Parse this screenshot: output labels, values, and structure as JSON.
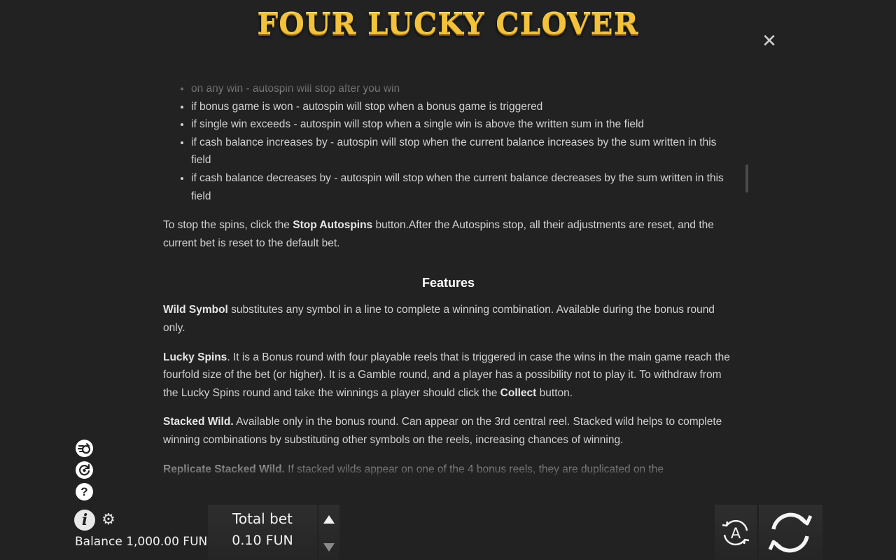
{
  "header": {
    "logo_text": "FOUR LUCKY CLOVER",
    "close_glyph": "✕"
  },
  "rules": {
    "autospin_stop_options": [
      "on any win - autospin will stop after you win",
      "if bonus game is won - autospin will stop when a bonus game is triggered",
      "if single win exceeds - autospin will stop when a single win is above the written sum in the field",
      "if cash balance increases by - autospin will stop when the current balance increases by the sum written in this field",
      "if cash balance decreases by - autospin will stop when the current balance decreases by the sum written in this field"
    ],
    "stop_para": {
      "before": "To stop the spins, click the ",
      "bold": "Stop Autospins",
      "after": " button.After the Autospins stop, all their adjustments are reset, and the current bet is reset to the default bet."
    },
    "features_heading": "Features",
    "wild": {
      "bold": "Wild Symbol",
      "text": " substitutes any symbol in a line to complete a winning combination. Available during the bonus round only."
    },
    "lucky_spins": {
      "bold": "Lucky Spins",
      "text": ". It is a Bonus round with four playable reels that is triggered in case the wins in the main game reach the fourfold size of the bet (or higher). It is a Gamble round, and a player has a possibility not to play it. To withdraw from the Lucky Spins round and take the winnings a player should click the ",
      "bold2": "Collect",
      "text2": " button."
    },
    "stacked_wild": {
      "bold": "Stacked Wild.",
      "text": " Available only in the bonus round. Can appear on the 3rd central reel. Stacked wild helps to complete winning combinations by substituting other symbols on the reels, increasing chances of winning."
    },
    "replicate": {
      "bold": "Replicate Stacked Wild.",
      "text": " If stacked wilds appear on one of the 4 bonus reels, they are duplicated on the"
    }
  },
  "sidebar": {
    "icons": [
      "turbo-icon",
      "autoplay-icon",
      "help-icon"
    ],
    "help_glyph": "?",
    "info_glyph": "i",
    "gear_glyph": "⚙"
  },
  "footer": {
    "balance": "Balance 1,000.00 FUN",
    "bet_label": "Total bet",
    "bet_value": "0.10 FUN",
    "auto_label": "A"
  }
}
